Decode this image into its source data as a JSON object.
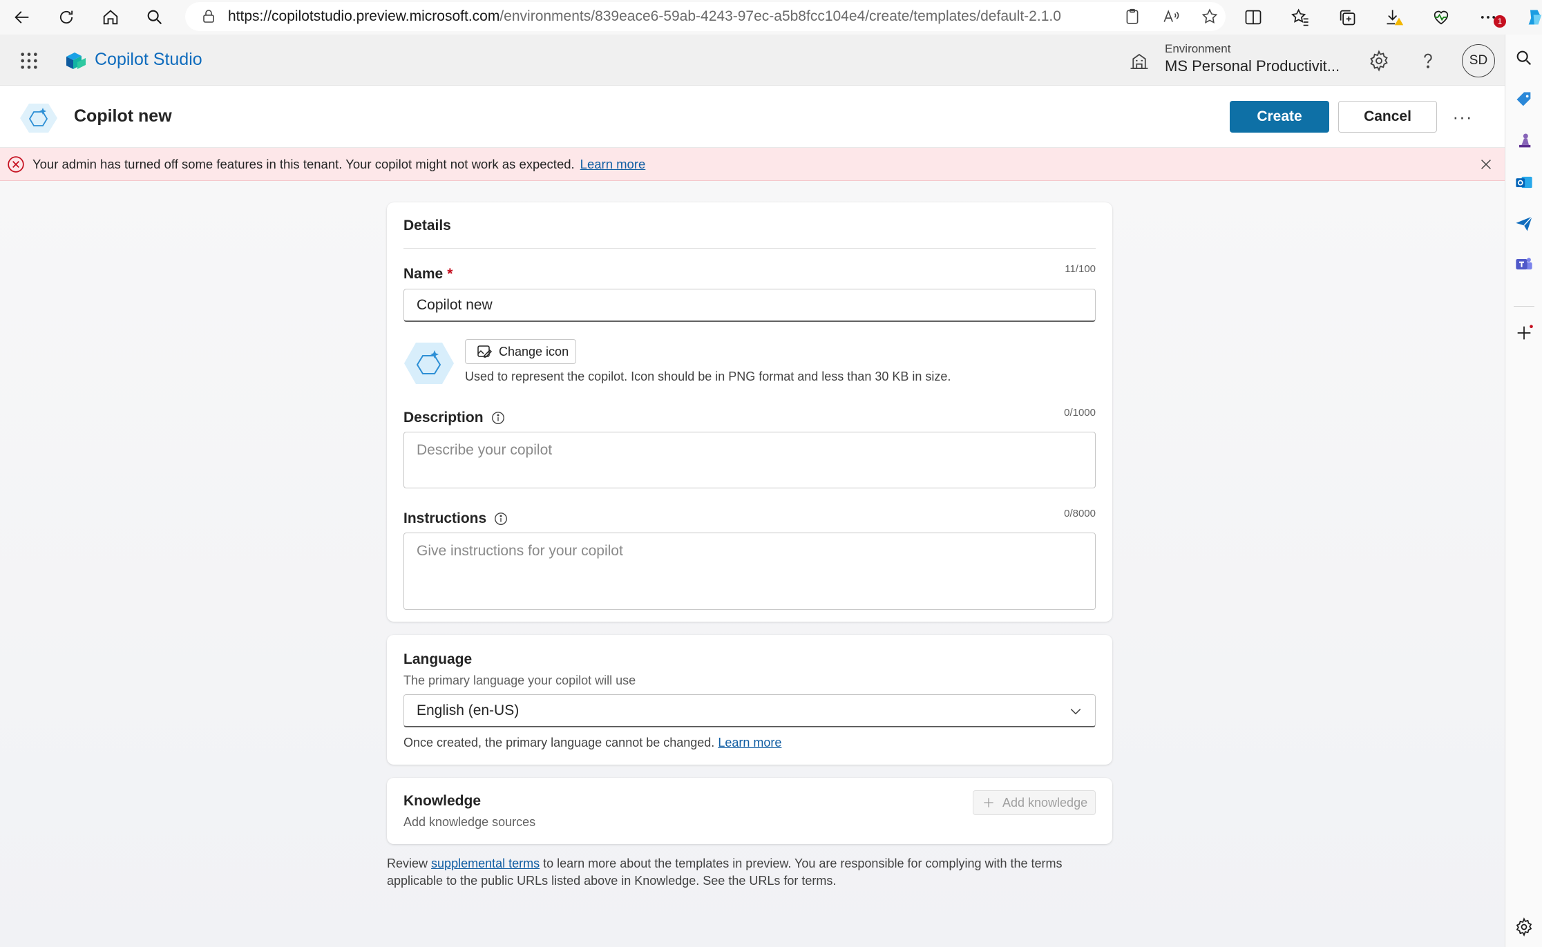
{
  "browser": {
    "url_host": "https://copilotstudio.preview.microsoft.com",
    "url_path": "/environments/839eace6-59ab-4243-97ec-a5b8fcc104e4/create/templates/default-2.1.0",
    "notification_badge": "1"
  },
  "header": {
    "brand": "Copilot Studio",
    "environment_label": "Environment",
    "environment_name": "MS Personal Productivit...",
    "avatar_initials": "SD"
  },
  "title_bar": {
    "title": "Copilot new",
    "create_label": "Create",
    "cancel_label": "Cancel",
    "more_label": "···"
  },
  "banner": {
    "message": "Your admin has turned off some features in this tenant. Your copilot might not work as expected.",
    "link": "Learn more"
  },
  "details": {
    "section_title": "Details",
    "name_label": "Name",
    "required_mark": "*",
    "name_counter": "11/100",
    "name_value": "Copilot new",
    "change_icon_label": "Change icon",
    "icon_help": "Used to represent the copilot. Icon should be in PNG format and less than 30 KB in size.",
    "description_label": "Description",
    "description_counter": "0/1000",
    "description_placeholder": "Describe your copilot",
    "instructions_label": "Instructions",
    "instructions_counter": "0/8000",
    "instructions_placeholder": "Give instructions for your copilot"
  },
  "language": {
    "section_title": "Language",
    "subtitle": "The primary language your copilot will use",
    "selected": "English (en-US)",
    "note": "Once created, the primary language cannot be changed.",
    "note_link": "Learn more"
  },
  "knowledge": {
    "section_title": "Knowledge",
    "subtitle": "Add knowledge sources",
    "add_label": "Add knowledge"
  },
  "footer": {
    "prefix": "Review",
    "link": "supplemental terms",
    "suffix": "to learn more about the templates in preview. You are responsible for complying with the terms applicable to the public URLs listed above in Knowledge. See the URLs for terms."
  },
  "colors": {
    "primary_button": "#0e70a6",
    "brand_text": "#0f6cbd",
    "banner_bg": "#fde7e9",
    "error_red": "#c50f1f"
  }
}
